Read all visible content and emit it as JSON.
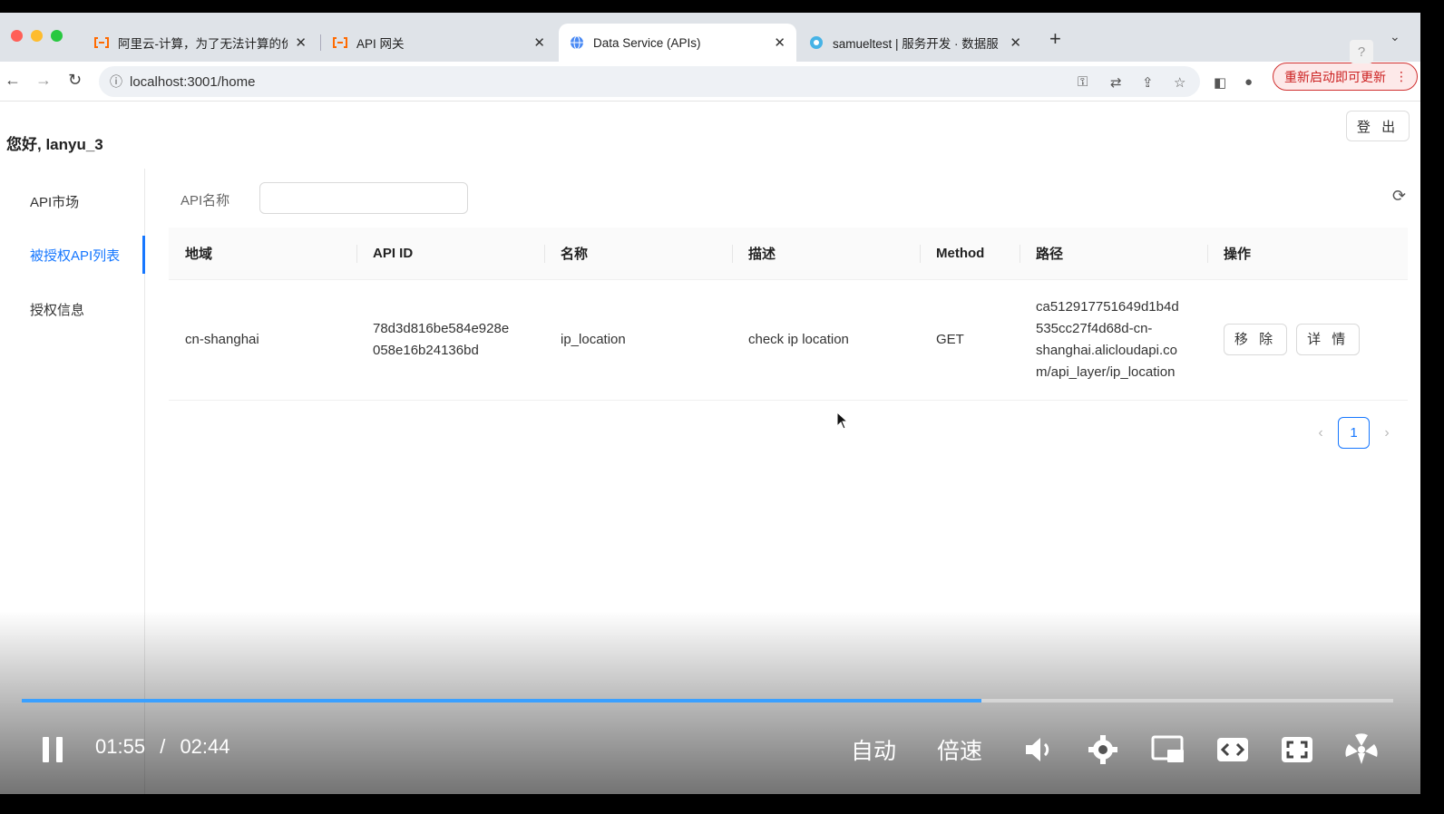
{
  "browser": {
    "tabs": [
      {
        "title": "阿里云-计算，为了无法计算的价",
        "favicon": "aliyun-icon"
      },
      {
        "title": "API 网关",
        "favicon": "aliyun-icon"
      },
      {
        "title": "Data Service (APIs)",
        "favicon": "globe-icon"
      },
      {
        "title": "samueltest | 服务开发 · 数据服",
        "favicon": "dataworks-icon"
      }
    ],
    "active_tab": 2,
    "url": "localhost:3001/home",
    "update_button": "重新启动即可更新",
    "help_badge": "?"
  },
  "page": {
    "greeting": "您好, lanyu_3",
    "logout_label": "登 出",
    "sidebar": {
      "items": [
        {
          "label": "API市场"
        },
        {
          "label": "被授权API列表"
        },
        {
          "label": "授权信息"
        }
      ],
      "active_index": 1
    },
    "filter": {
      "label": "API名称",
      "value": ""
    },
    "table": {
      "columns": [
        "地域",
        "API ID",
        "名称",
        "描述",
        "Method",
        "路径",
        "操作"
      ],
      "rows": [
        {
          "region": "cn-shanghai",
          "api_id_1": "78d3d816be584e928e",
          "api_id_2": "058e16b24136bd",
          "name": "ip_location",
          "description": "check ip location",
          "method": "GET",
          "path_1": "ca512917751649d1b4d",
          "path_2": "535cc27f4d68d-cn-",
          "path_3": "shanghai.alicloudapi.co",
          "path_4": "m/api_layer/ip_location",
          "remove_label": "移 除",
          "detail_label": "详 情"
        }
      ]
    },
    "pagination": {
      "current_page": "1"
    }
  },
  "video_player": {
    "current_time": "01:55",
    "separator": "/",
    "duration": "02:44",
    "progress_fraction": 0.7,
    "quality_label": "自动",
    "speed_label": "倍速"
  }
}
